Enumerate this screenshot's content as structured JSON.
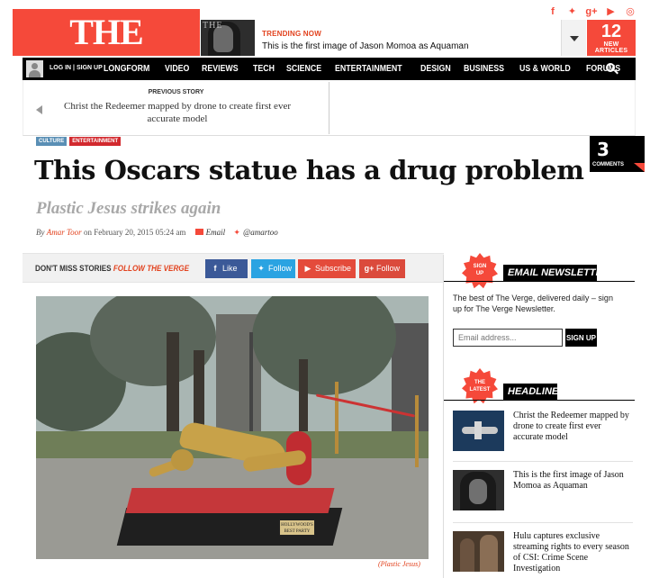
{
  "masthead": {
    "logo": "THE VERGE",
    "trending_label": "TRENDING NOW",
    "trending_title": "This is the first image of Jason Momoa as Aquaman",
    "trending_thumb_text": "THE",
    "new_articles_count": "12",
    "new_articles_label": "NEW ARTICLES",
    "social_icons": [
      "facebook-icon",
      "twitter-icon",
      "google-plus-icon",
      "youtube-icon",
      "rss-icon"
    ]
  },
  "nav": {
    "login": "LOG IN | SIGN UP",
    "items": [
      "LONGFORM",
      "VIDEO",
      "REVIEWS",
      "TECH",
      "SCIENCE",
      "ENTERTAINMENT",
      "DESIGN",
      "BUSINESS",
      "US & WORLD",
      "FORUMS"
    ]
  },
  "previous_story": {
    "label": "PREVIOUS STORY",
    "title": "Christ the Redeemer mapped by drone to create first ever accurate model"
  },
  "article": {
    "tags": [
      "CULTURE",
      "ENTERTAINMENT"
    ],
    "headline": "This Oscars statue has a drug problem",
    "subhead": "Plastic Jesus strikes again",
    "by": "By",
    "author": "Amar Toor",
    "date": "on February 20, 2015 05:24 am",
    "email_label": "Email",
    "twitter_handle": "@amartoo",
    "comments_count": "3",
    "comments_label": "COMMENTS",
    "image_caption": "(Plastic Jesus)",
    "image_sign_text": "HOLLYWOOD'S BEST PARTY"
  },
  "follow_bar": {
    "dont_miss": "DON'T MISS STORIES",
    "follow_verge": "FOLLOW THE VERGE",
    "facebook": "Like",
    "twitter": "Follow",
    "youtube": "Subscribe",
    "googleplus": "Follow"
  },
  "sidebar": {
    "newsletter_badge": [
      "SIGN",
      "UP"
    ],
    "newsletter_title": "EMAIL NEWSLETTER",
    "newsletter_desc": "The best of The Verge, delivered daily – sign up for The Verge Newsletter.",
    "email_placeholder": "Email address...",
    "signup_button": "SIGN UP",
    "latest_badge": [
      "THE",
      "LATEST"
    ],
    "headlines_title": "HEADLINES",
    "headlines": [
      "Christ the Redeemer mapped by drone to create first ever accurate model",
      "This is the first image of Jason Momoa as Aquaman",
      "Hulu captures exclusive streaming rights to every season of CSI: Crime Scene Investigation"
    ]
  },
  "colors": {
    "brand": "#f5493a",
    "nav_bg": "#000000",
    "facebook": "#3b5998",
    "twitter": "#2aa3e2",
    "youtube": "#e44b3b",
    "googleplus": "#db4a3c"
  }
}
